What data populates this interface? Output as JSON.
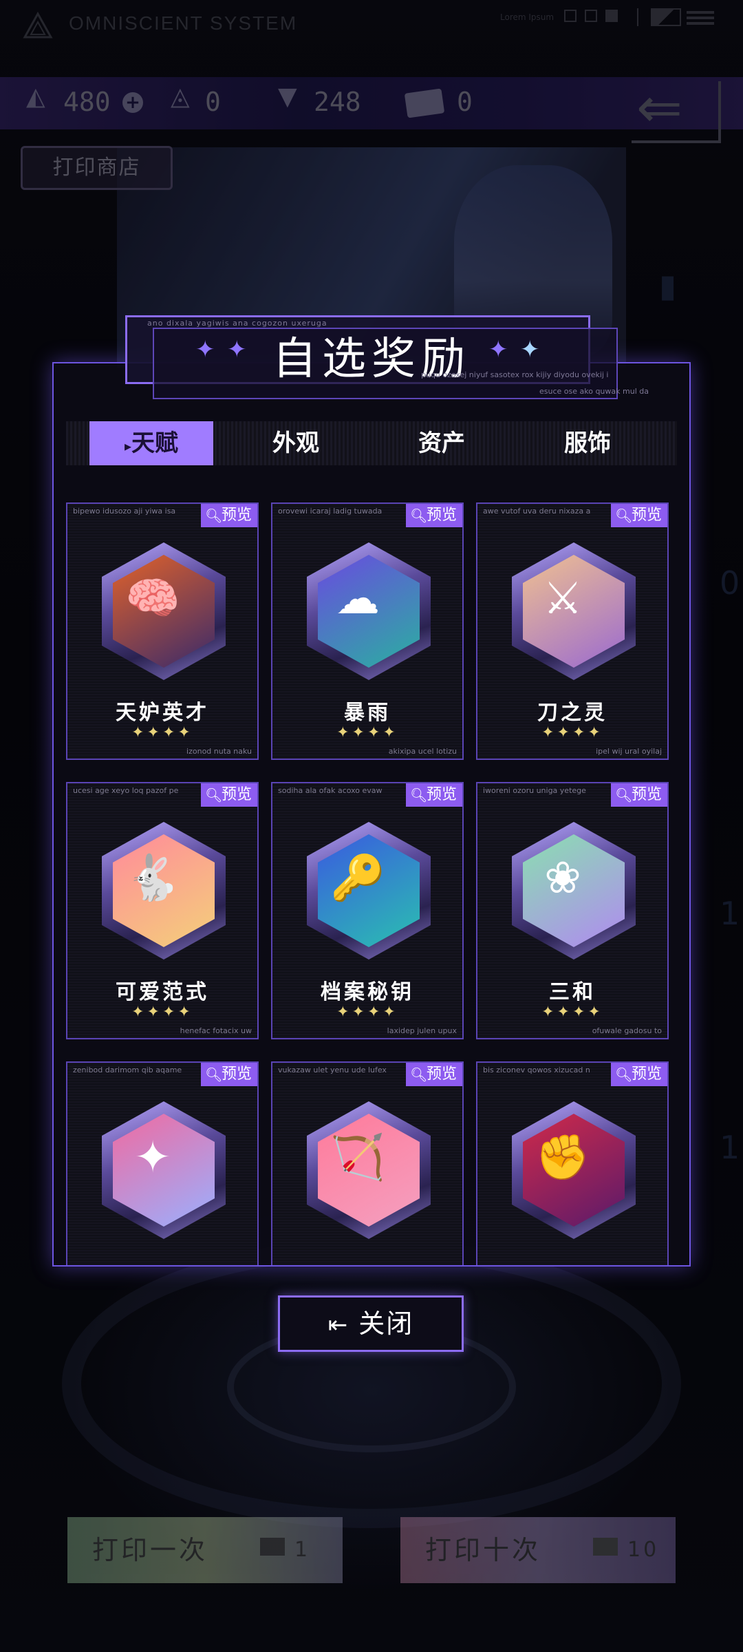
{
  "system": {
    "title": "OMNISCIENT SYSTEM",
    "top_right_text": "Lorem Ipsum"
  },
  "currencies": [
    {
      "icon": "prism-icon",
      "value": "480"
    },
    {
      "icon": "prism-outline-icon",
      "value": "0"
    },
    {
      "icon": "gem-icon",
      "value": "248"
    },
    {
      "icon": "ticket-icon",
      "value": "0"
    }
  ],
  "shop_tag": "打印商店",
  "dialog": {
    "title": "自选奖励",
    "noise_top": "ano dixala yagiwis ana cogozon uxeruga",
    "noise_right_1": "puqu ozoxej niyuf sasotex rox kijiy diyodu ovekij i",
    "noise_right_2": "esuce ose ako quwak mul da"
  },
  "tabs": [
    {
      "label": "天赋",
      "active": true
    },
    {
      "label": "外观",
      "active": false
    },
    {
      "label": "资产",
      "active": false
    },
    {
      "label": "服饰",
      "active": false
    }
  ],
  "preview_label": "预览",
  "cards": [
    {
      "name": "天妒英才",
      "stars": "✦✦✦✦",
      "top": "bipewo idusozo aji yiwa isa",
      "bottom": "izonod nuta naku",
      "icon": "genius-brain-icon",
      "glyph": "🧠",
      "colors": [
        "#e2622a",
        "#3a2a6a"
      ]
    },
    {
      "name": "暴雨",
      "stars": "✦✦✦✦",
      "top": "orovewi icaraj ladig tuwada",
      "bottom": "akixipa ucel lotizu",
      "icon": "rainstorm-icon",
      "glyph": "☁",
      "colors": [
        "#6a4ae0",
        "#2ab0a0"
      ]
    },
    {
      "name": "刀之灵",
      "stars": "✦✦✦✦",
      "top": "awe vutof uva deru nixaza a",
      "bottom": "ipel wij ural oyilaj",
      "icon": "blade-spirit-icon",
      "glyph": "⚔",
      "colors": [
        "#f0c090",
        "#9a6ad0"
      ]
    },
    {
      "name": "可爱范式",
      "stars": "✦✦✦✦",
      "top": "ucesi age xeyo loq pazof pe",
      "bottom": "henefac fotacix uw",
      "icon": "bunny-icon",
      "glyph": "🐇",
      "colors": [
        "#ff8a9a",
        "#f4d07a"
      ]
    },
    {
      "name": "档案秘钥",
      "stars": "✦✦✦✦",
      "top": "sodiha ala ofak acoxo evaw",
      "bottom": "laxidep julen upux",
      "icon": "archive-key-icon",
      "glyph": "🔑",
      "colors": [
        "#3a5ae0",
        "#2ac0b0"
      ]
    },
    {
      "name": "三和",
      "stars": "✦✦✦✦",
      "top": "iworeni ozoru uniga yetege",
      "bottom": "ofuwale gadosu to",
      "icon": "lotus-icon",
      "glyph": "❀",
      "colors": [
        "#8adfb0",
        "#b08af0"
      ]
    },
    {
      "name": "",
      "stars": "",
      "top": "zenibod darimom qib aqame",
      "bottom": "",
      "icon": "sparkle-document-icon",
      "glyph": "✦",
      "colors": [
        "#f06aa0",
        "#9ab0ff"
      ]
    },
    {
      "name": "",
      "stars": "",
      "top": "vukazaw ulet yenu ude lufex",
      "bottom": "",
      "icon": "bow-arrow-icon",
      "glyph": "🏹",
      "colors": [
        "#ff7a9a",
        "#f4a0c0"
      ]
    },
    {
      "name": "",
      "stars": "",
      "top": "bis ziconev qowos xizucad n",
      "bottom": "",
      "icon": "raised-fist-icon",
      "glyph": "✊",
      "colors": [
        "#d02a4a",
        "#5a1a6a"
      ]
    }
  ],
  "close_button": "关闭",
  "bottom_buttons": [
    {
      "label": "打印一次",
      "cost": "1"
    },
    {
      "label": "打印十次",
      "cost": "10"
    }
  ]
}
